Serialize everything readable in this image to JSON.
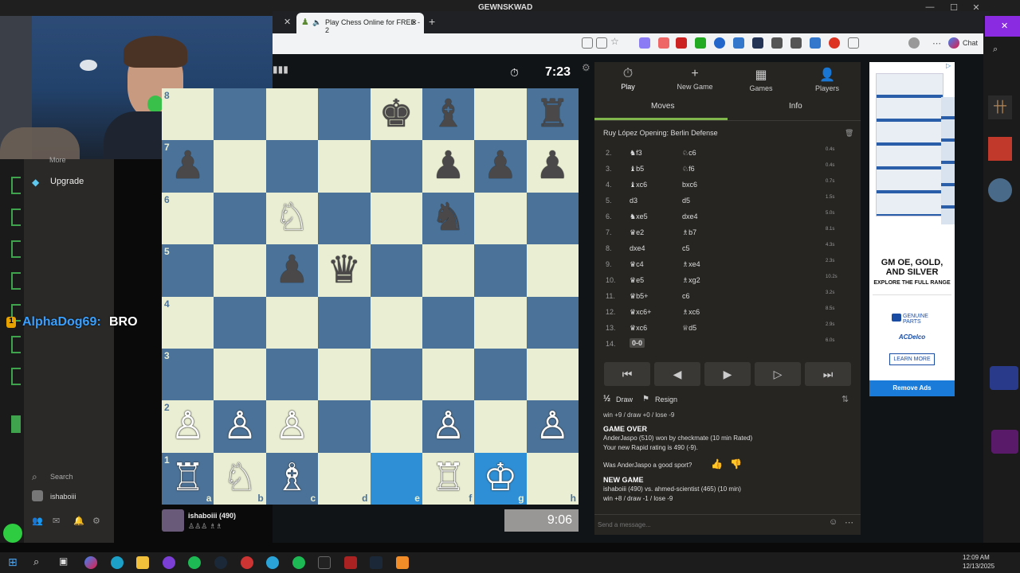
{
  "os": {
    "title": "GEWNSKWAD",
    "clock_time": "12:09 AM",
    "clock_date": "12/13/2025"
  },
  "browser": {
    "tab_title": "Play Chess Online for FREE - 2"
  },
  "toolbar": {
    "chat_label": "Chat"
  },
  "sidebar": {
    "more_label": "More",
    "upgrade_label": "Upgrade",
    "search_label": "Search",
    "user_label": "ishaboiii"
  },
  "chat_overlay": {
    "user": "AlphaDog69:",
    "message": "BRO",
    "badge": "1"
  },
  "board_header": {
    "timer": "7:23"
  },
  "player_bottom": {
    "name": "ishaboiii (490)",
    "clock": "9:06"
  },
  "board": {
    "ranks": [
      "8",
      "7",
      "6",
      "5",
      "4",
      "3",
      "2",
      "1"
    ],
    "files": [
      "a",
      "b",
      "c",
      "d",
      "e",
      "f",
      "g",
      "h"
    ],
    "squares": [
      [
        "",
        "",
        "",
        "",
        "♚",
        "♝",
        "",
        "♜"
      ],
      [
        "♟",
        "",
        "",
        "",
        "",
        "♟",
        "♟",
        "♟"
      ],
      [
        "",
        "",
        "♘",
        "",
        "",
        "♞",
        "",
        ""
      ],
      [
        "",
        "",
        "♟",
        "♛",
        "",
        "",
        "",
        ""
      ],
      [
        "",
        "",
        "",
        "",
        "",
        "",
        "",
        ""
      ],
      [
        "",
        "",
        "",
        "",
        "",
        "",
        "",
        ""
      ],
      [
        "♙",
        "♙",
        "♙",
        "",
        "",
        "♙",
        "",
        "♙"
      ],
      [
        "♖",
        "♘",
        "♗",
        "",
        "",
        "♖",
        "♔",
        ""
      ]
    ],
    "colors": [
      [
        "",
        "",
        "",
        "",
        "b",
        "b",
        "",
        "b"
      ],
      [
        "b",
        "",
        "",
        "",
        "",
        "b",
        "b",
        "b"
      ],
      [
        "",
        "",
        "w",
        "",
        "",
        "b",
        "",
        ""
      ],
      [
        "",
        "",
        "b",
        "b",
        "",
        "",
        "",
        ""
      ],
      [
        "",
        "",
        "",
        "",
        "",
        "",
        "",
        ""
      ],
      [
        "",
        "",
        "",
        "",
        "",
        "",
        "",
        ""
      ],
      [
        "w",
        "w",
        "w",
        "",
        "",
        "w",
        "",
        "w"
      ],
      [
        "w",
        "w",
        "w",
        "",
        "",
        "w",
        "w",
        ""
      ]
    ],
    "highlight": [
      "e1",
      "g1"
    ]
  },
  "panel": {
    "nav": [
      {
        "icon": "⏱",
        "label": "Play"
      },
      {
        "icon": "+",
        "label": "New Game"
      },
      {
        "icon": "▦",
        "label": "Games"
      },
      {
        "icon": "👤",
        "label": "Players"
      }
    ],
    "tabs": [
      "Moves",
      "Info"
    ],
    "opening": "Ruy López Opening: Berlin Defense",
    "moves": [
      {
        "n": "2.",
        "w": "♞f3",
        "b": "♘c6",
        "t": "0.4s"
      },
      {
        "n": "3.",
        "w": "♝b5",
        "b": "♘f6",
        "t": "0.4s"
      },
      {
        "n": "4.",
        "w": "♝xc6",
        "b": "bxc6",
        "t": "0.7s"
      },
      {
        "n": "5.",
        "w": "d3",
        "b": "d5",
        "t": "1.5s"
      },
      {
        "n": "6.",
        "w": "♞xe5",
        "b": "dxe4",
        "t": "5.0s"
      },
      {
        "n": "7.",
        "w": "♛e2",
        "b": "♗b7",
        "t": "8.1s"
      },
      {
        "n": "8.",
        "w": "dxe4",
        "b": "c5",
        "t": "4.3s"
      },
      {
        "n": "9.",
        "w": "♛c4",
        "b": "♗xe4",
        "t": "2.3s"
      },
      {
        "n": "10.",
        "w": "♛e5",
        "b": "♗xg2",
        "t": "10.2s"
      },
      {
        "n": "11.",
        "w": "♛b5+",
        "b": "c6",
        "t": "3.2s"
      },
      {
        "n": "12.",
        "w": "♛xc6+",
        "b": "♗xc6",
        "t": "8.5s"
      },
      {
        "n": "13.",
        "w": "♛xc6",
        "b": "♕d5",
        "t": "2.9s"
      },
      {
        "n": "14.",
        "w": "0-0",
        "b": "",
        "t": "6.0s"
      }
    ],
    "draw_label": "Draw",
    "resign_label": "Resign",
    "record_line": "win +9 / draw +0 / lose -9",
    "game_over_title": "GAME OVER",
    "game_over_text": "AnderJaspo (510) won by checkmate (10 min Rated)",
    "rating_text": "Your new Rapid rating is 490 (-9).",
    "sport_question": "Was AnderJaspo a good sport?",
    "new_game_title": "NEW GAME",
    "new_game_text": "ishaboiii (490) vs. ahmed-scientist (465) (10 min)",
    "new_game_record": "win +8 / draw -1 / lose -9",
    "message_placeholder": "Send a message..."
  },
  "ad": {
    "headline": "GM OE, GOLD, AND SILVER",
    "sub": "EXPLORE THE FULL RANGE",
    "brand1": "GENUINE PARTS",
    "brand2": "ACDelco",
    "cta": "LEARN MORE",
    "remove": "Remove Ads"
  }
}
